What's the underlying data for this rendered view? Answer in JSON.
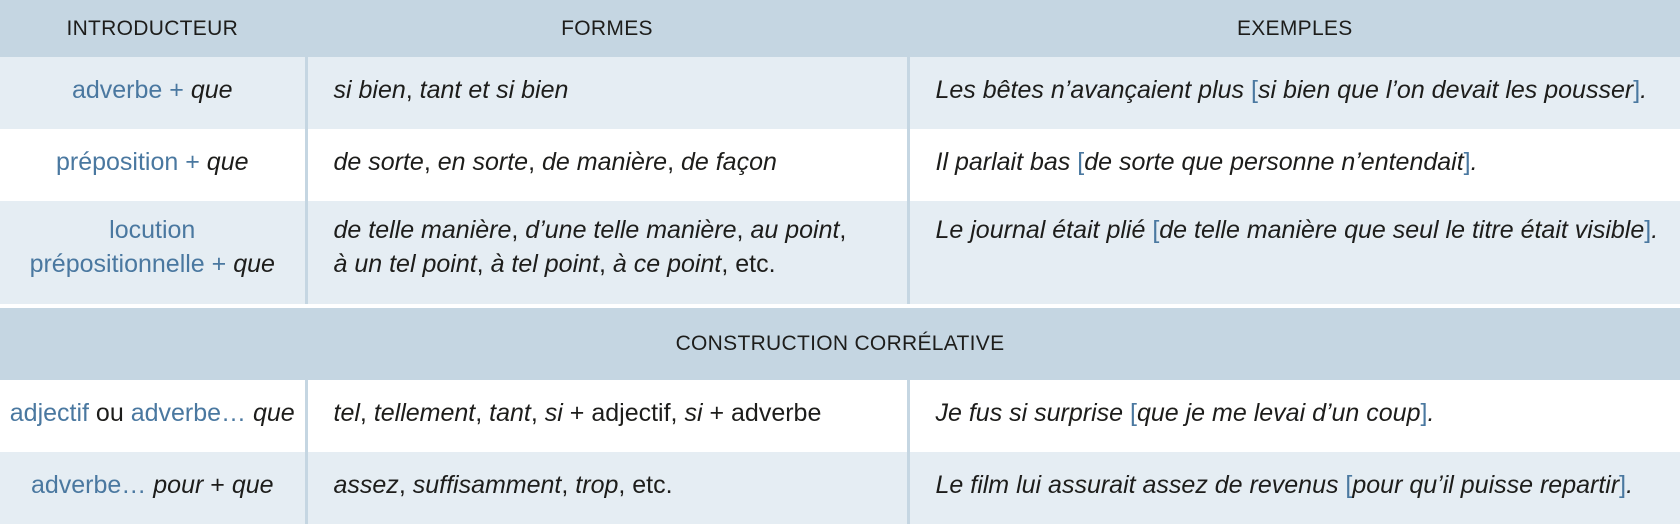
{
  "header": {
    "col_introducteur": "INTRODUCTEUR",
    "col_formes": "FORMES",
    "col_exemples": "EXEMPLES"
  },
  "rows": [
    {
      "intro": [
        {
          "t": "adverbe",
          "s": "blue"
        },
        {
          "t": " + ",
          "s": "blue"
        },
        {
          "t": "que",
          "s": "it"
        }
      ],
      "forms": [
        {
          "t": "si bien",
          "s": "it"
        },
        {
          "t": ", "
        },
        {
          "t": "tant et si bien",
          "s": "it"
        }
      ],
      "example": [
        {
          "t": "Les bêtes n’avançaient plus ",
          "s": "it"
        },
        {
          "t": "[",
          "s": "blue"
        },
        {
          "t": "si bien que l’on devait les pousser",
          "s": "it"
        },
        {
          "t": "]",
          "s": "blue"
        },
        {
          "t": ".",
          "s": "it"
        }
      ]
    },
    {
      "intro": [
        {
          "t": "préposition",
          "s": "blue"
        },
        {
          "t": " + ",
          "s": "blue"
        },
        {
          "t": "que",
          "s": "it"
        }
      ],
      "forms": [
        {
          "t": "de sorte",
          "s": "it"
        },
        {
          "t": ", "
        },
        {
          "t": "en sorte",
          "s": "it"
        },
        {
          "t": ", "
        },
        {
          "t": "de manière",
          "s": "it"
        },
        {
          "t": ", "
        },
        {
          "t": "de façon",
          "s": "it"
        }
      ],
      "example": [
        {
          "t": "Il parlait bas ",
          "s": "it"
        },
        {
          "t": "[",
          "s": "blue"
        },
        {
          "t": "de sorte que personne n’entendait",
          "s": "it"
        },
        {
          "t": "]",
          "s": "blue"
        },
        {
          "t": ".",
          "s": "it"
        }
      ]
    },
    {
      "intro": [
        {
          "t": "locution",
          "s": "blue"
        },
        {
          "br": true
        },
        {
          "t": "prépositionnelle",
          "s": "blue"
        },
        {
          "t": " + ",
          "s": "blue"
        },
        {
          "t": "que",
          "s": "it"
        }
      ],
      "forms": [
        {
          "t": "de telle manière",
          "s": "it"
        },
        {
          "t": ", "
        },
        {
          "t": "d’une telle manière",
          "s": "it"
        },
        {
          "t": ", "
        },
        {
          "t": "au point",
          "s": "it"
        },
        {
          "t": ","
        },
        {
          "br": true
        },
        {
          "t": "à un tel point",
          "s": "it"
        },
        {
          "t": ", "
        },
        {
          "t": "à tel point",
          "s": "it"
        },
        {
          "t": ", "
        },
        {
          "t": "à ce point",
          "s": "it"
        },
        {
          "t": ", etc."
        }
      ],
      "example": [
        {
          "t": "Le journal était plié ",
          "s": "it"
        },
        {
          "t": "[",
          "s": "blue"
        },
        {
          "t": "de telle manière que seul le titre était visible",
          "s": "it"
        },
        {
          "t": "]",
          "s": "blue"
        },
        {
          "t": ".",
          "s": "it"
        }
      ]
    }
  ],
  "section_title": "CONSTRUCTION CORRÉLATIVE",
  "rows2": [
    {
      "intro": [
        {
          "t": "adjectif",
          "s": "blue"
        },
        {
          "t": " ou "
        },
        {
          "t": "adverbe…",
          "s": "blue"
        },
        {
          "t": " "
        },
        {
          "t": "que",
          "s": "it"
        }
      ],
      "forms": [
        {
          "t": "tel",
          "s": "it"
        },
        {
          "t": ", "
        },
        {
          "t": "tellement",
          "s": "it"
        },
        {
          "t": ", "
        },
        {
          "t": "tant",
          "s": "it"
        },
        {
          "t": ", "
        },
        {
          "t": "si",
          "s": "it"
        },
        {
          "t": " + adjectif, "
        },
        {
          "t": "si",
          "s": "it"
        },
        {
          "t": " + adverbe"
        }
      ],
      "example": [
        {
          "t": "Je fus si surprise ",
          "s": "it"
        },
        {
          "t": "[",
          "s": "blue"
        },
        {
          "t": "que je me levai d’un coup",
          "s": "it"
        },
        {
          "t": "]",
          "s": "blue"
        },
        {
          "t": ".",
          "s": "it"
        }
      ]
    },
    {
      "intro": [
        {
          "t": "adverbe…",
          "s": "blue"
        },
        {
          "t": " "
        },
        {
          "t": "pour",
          "s": "it"
        },
        {
          "t": " + "
        },
        {
          "t": "que",
          "s": "it"
        }
      ],
      "forms": [
        {
          "t": "assez",
          "s": "it"
        },
        {
          "t": ", "
        },
        {
          "t": "suffisamment",
          "s": "it"
        },
        {
          "t": ", "
        },
        {
          "t": "trop",
          "s": "it"
        },
        {
          "t": ", etc."
        }
      ],
      "example": [
        {
          "t": "Le film lui assurait assez de revenus ",
          "s": "it"
        },
        {
          "t": "[",
          "s": "blue"
        },
        {
          "t": "pour qu’il puisse repartir",
          "s": "it"
        },
        {
          "t": "]",
          "s": "blue"
        },
        {
          "t": ".",
          "s": "it"
        }
      ]
    }
  ]
}
